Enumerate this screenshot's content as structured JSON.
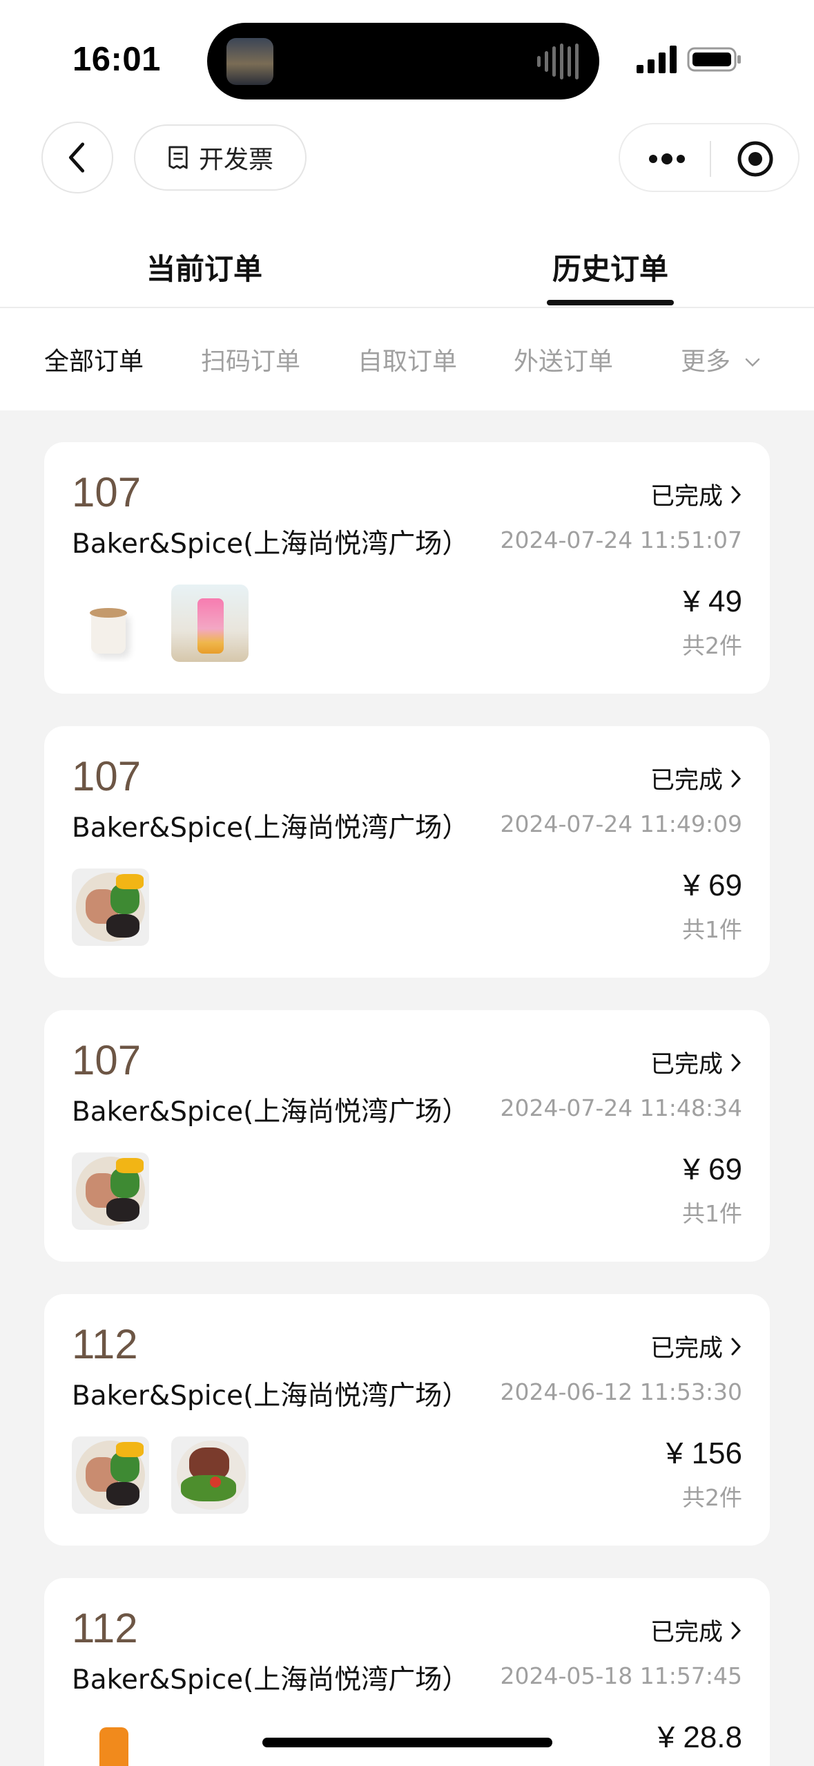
{
  "status_bar": {
    "time": "16:01"
  },
  "nav": {
    "invoice_label": "开发票"
  },
  "tabs": [
    {
      "label": "当前订单",
      "active": false
    },
    {
      "label": "历史订单",
      "active": true
    }
  ],
  "filters": [
    {
      "label": "全部订单",
      "active": true
    },
    {
      "label": "扫码订单",
      "active": false
    },
    {
      "label": "自取订单",
      "active": false
    },
    {
      "label": "外送订单",
      "active": false
    },
    {
      "label": "更多",
      "active": false
    }
  ],
  "orders": [
    {
      "number": "107",
      "status": "已完成",
      "store": "Baker&Spice(上海尚悦湾广场）",
      "time": "2024-07-24 11:51:07",
      "price": "¥ 49",
      "count": "共2件",
      "items": [
        "coffee-thumbnail",
        "pink-drink-thumbnail"
      ]
    },
    {
      "number": "107",
      "status": "已完成",
      "store": "Baker&Spice(上海尚悦湾广场）",
      "time": "2024-07-24 11:49:09",
      "price": "¥ 69",
      "count": "共1件",
      "items": [
        "salad-bowl-thumbnail"
      ]
    },
    {
      "number": "107",
      "status": "已完成",
      "store": "Baker&Spice(上海尚悦湾广场）",
      "time": "2024-07-24 11:48:34",
      "price": "¥ 69",
      "count": "共1件",
      "items": [
        "salad-bowl-thumbnail"
      ]
    },
    {
      "number": "112",
      "status": "已完成",
      "store": "Baker&Spice(上海尚悦湾广场）",
      "time": "2024-06-12 11:53:30",
      "price": "¥ 156",
      "count": "共2件",
      "items": [
        "salad-bowl-thumbnail",
        "steak-salad-thumbnail"
      ]
    },
    {
      "number": "112",
      "status": "已完成",
      "store": "Baker&Spice(上海尚悦湾广场）",
      "time": "2024-05-18 11:57:45",
      "price": "¥ 28.8",
      "count": "",
      "items": [
        "orange-drink-thumbnail"
      ]
    }
  ],
  "colors": {
    "order_number": "#6d5645",
    "muted_text": "#a0a0a0",
    "page_background": "#f3f3f3"
  }
}
